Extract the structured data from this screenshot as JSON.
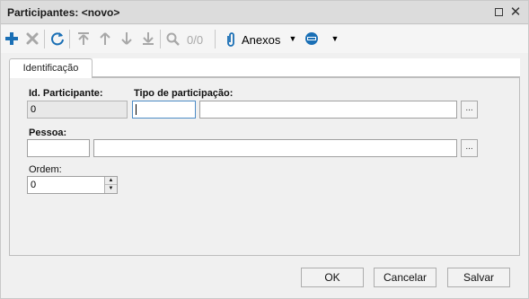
{
  "window": {
    "title": "Participantes: <novo>",
    "close_glyph": "✕"
  },
  "toolbar": {
    "add_icon": "plus-icon",
    "delete_icon": "delete-icon",
    "refresh_icon": "refresh-icon",
    "record_counter": "0/0",
    "attachments_label": "Anexos"
  },
  "tabs": [
    {
      "label": "Identificação",
      "active": true
    }
  ],
  "form": {
    "id_label": "Id. Participante:",
    "id_value": "0",
    "tipo_label": "Tipo de participação:",
    "tipo_code_value": "",
    "tipo_desc_value": "",
    "pessoa_label": "Pessoa:",
    "pessoa_code_value": "",
    "pessoa_desc_value": "",
    "ordem_label": "Ordem:",
    "ordem_value": "0",
    "lookup_button_label": "..."
  },
  "footer": {
    "ok_label": "OK",
    "cancel_label": "Cancelar",
    "save_label": "Salvar"
  },
  "colors": {
    "accent": "#1a6fb5",
    "focus_border": "#4d8cc6",
    "window_bg": "#f0f0f0"
  }
}
